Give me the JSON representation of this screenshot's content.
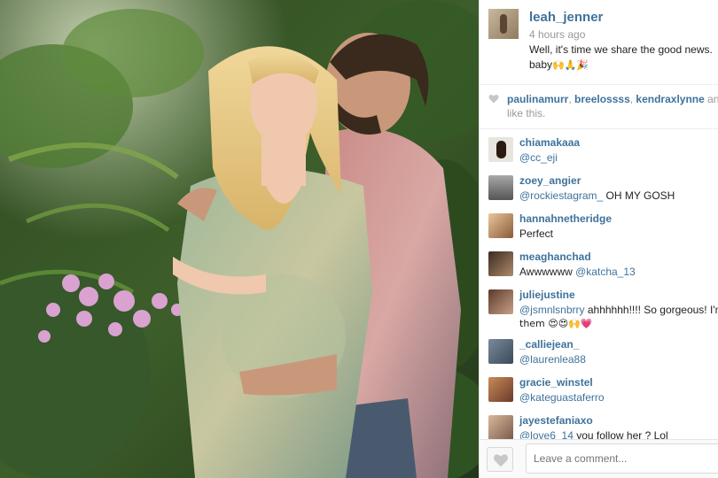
{
  "photo": {
    "description_icon": "photo-image"
  },
  "post": {
    "username": "leah_jenner",
    "time": "4 hours ago",
    "caption_line1": "Well, it's time we share the good news. ",
    "caption_line2": "baby",
    "caption_emoji": "🙌🙏🎉"
  },
  "likes": {
    "user1": "paulinamurr",
    "user2": "breelossss",
    "user3": "kendraxlynne",
    "and": " and",
    "like_this": "like this."
  },
  "comments": [
    {
      "user": "chiamakaaa",
      "mention": "@cc_eji",
      "text": "",
      "line2": ""
    },
    {
      "user": "zoey_angier",
      "mention": "@rockiestagram_",
      "text": " OH MY GOSH",
      "line2": ""
    },
    {
      "user": "hannahnetheridge",
      "mention": "",
      "text": "Perfect",
      "line2": ""
    },
    {
      "user": "meaghanchad",
      "mention": "",
      "text": "Awwwwww ",
      "mention2": "@katcha_13",
      "line2": ""
    },
    {
      "user": "juliejustine",
      "mention": "@jsmnlsnbrry",
      "text": " ahhhhhh!!!! So gorgeous! I'm",
      "line2": "them 😍😍🙌💗"
    },
    {
      "user": "_calliejean_",
      "mention": "@laurenlea88",
      "text": "",
      "line2": ""
    },
    {
      "user": "gracie_winstel",
      "mention": "@kateguastaferro",
      "text": "",
      "line2": ""
    },
    {
      "user": "jayestefaniaxo",
      "mention": "@love6_14",
      "text": " you follow her ? Lol",
      "line2": ""
    }
  ],
  "footer": {
    "comment_placeholder": "Leave a comment..."
  },
  "colors": {
    "link": "#3f729b",
    "muted": "#999999"
  }
}
